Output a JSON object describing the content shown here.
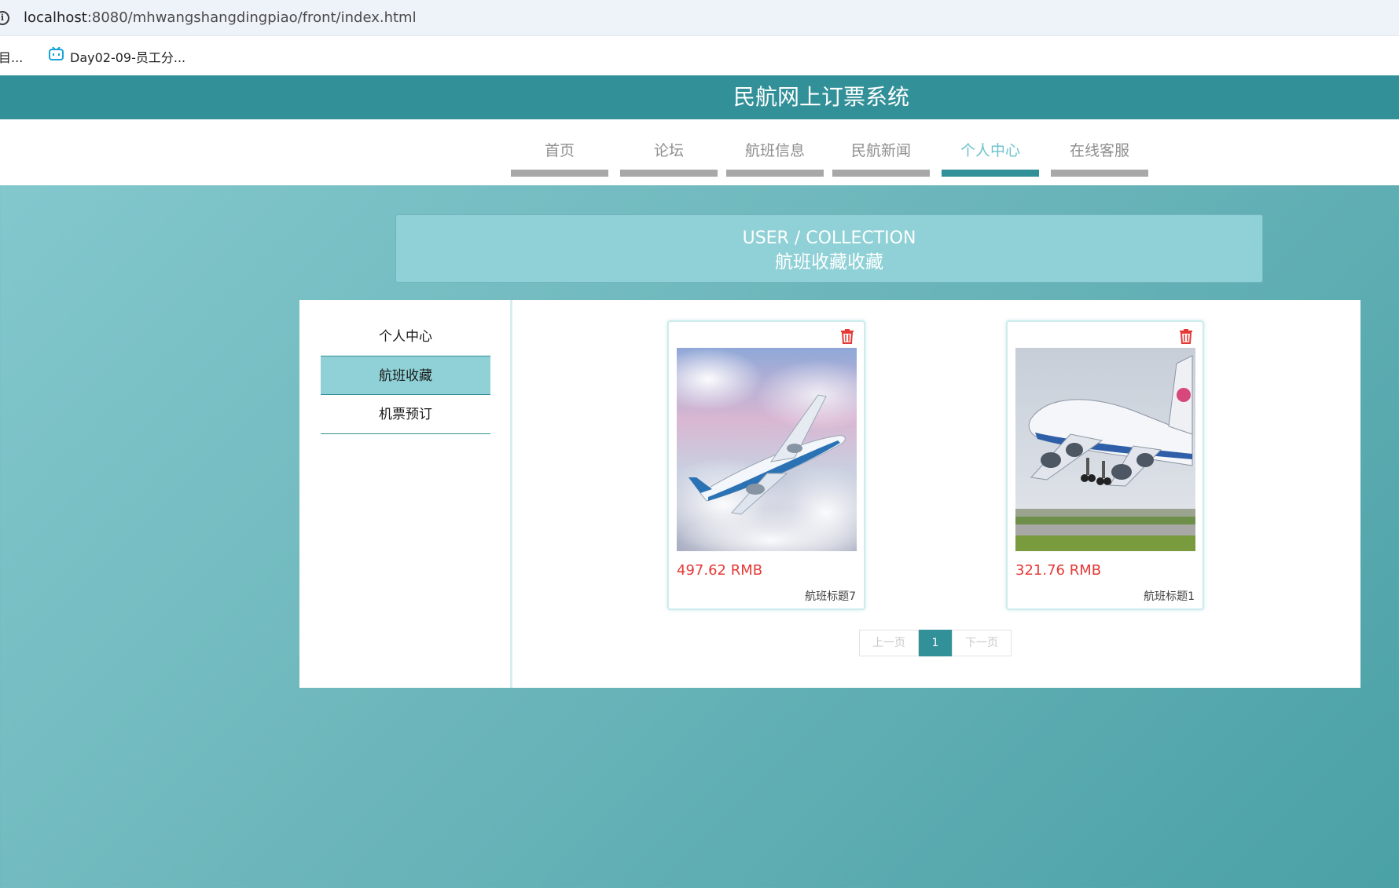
{
  "browser": {
    "url_host": "localhost",
    "url_rest": ":8080/mhwangshangdingpiao/front/index.html",
    "bookmarks": [
      {
        "label": "目..."
      },
      {
        "label": "Day02-09-员工分..."
      }
    ]
  },
  "site": {
    "title": "民航网上订票系统"
  },
  "nav": {
    "items": [
      {
        "label": "首页"
      },
      {
        "label": "论坛"
      },
      {
        "label": "航班信息"
      },
      {
        "label": "民航新闻"
      },
      {
        "label": "个人中心"
      },
      {
        "label": "在线客服"
      }
    ],
    "active": "个人中心"
  },
  "banner": {
    "en": "USER / COLLECTION",
    "cn": "航班收藏收藏"
  },
  "sidebar": {
    "items": [
      {
        "label": "个人中心"
      },
      {
        "label": "航班收藏"
      },
      {
        "label": "机票预订"
      }
    ],
    "active": "航班收藏"
  },
  "cards": [
    {
      "price": "497.62 RMB",
      "title": "航班标题7",
      "image": "airliner-in-clouds"
    },
    {
      "price": "321.76 RMB",
      "title": "航班标题1",
      "image": "jumbo-jet-landing"
    }
  ],
  "pagination": {
    "prev": "上一页",
    "current": "1",
    "next": "下一页"
  },
  "colors": {
    "primary": "#329098",
    "light_accent": "#8fd1d6",
    "price": "#e53935"
  }
}
